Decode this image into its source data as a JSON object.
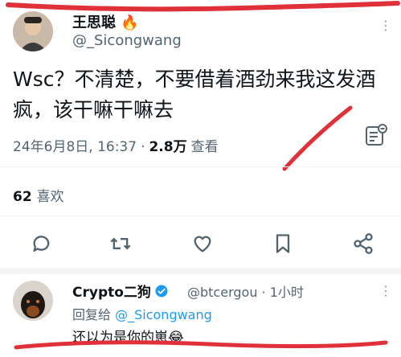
{
  "tweet": {
    "author_name": "王思聪",
    "author_emoji": "🔥",
    "author_handle": "@_Sicongwang",
    "more_label": "⋮",
    "text_line1": "Wsc？不清楚，不要借着酒劲来我这发酒",
    "text_line2": "疯，该干嘛干嘛去",
    "date": "24年6月8日, 16:37",
    "dot": "·",
    "views_count": "2.8万",
    "views_label": "查看",
    "likes_count": "62",
    "likes_label": "喜欢",
    "actions": [
      "reply-icon",
      "retweet-icon",
      "like-icon",
      "bookmark-icon",
      "share-icon"
    ]
  },
  "reply": {
    "author_name": "Crypto二狗",
    "author_handle": "@btcergou",
    "time": "· 1小时",
    "more_label": "⋮",
    "reply_to_prefix": "回复给",
    "reply_to_mention": "@_Sicongwang",
    "text": "还以为是你的崽",
    "text_emoji": "😂"
  },
  "colors": {
    "accent": "#1d9bf0",
    "verified": "#1d9bf0",
    "muted": "#536471",
    "annotation": "#e0303a"
  }
}
